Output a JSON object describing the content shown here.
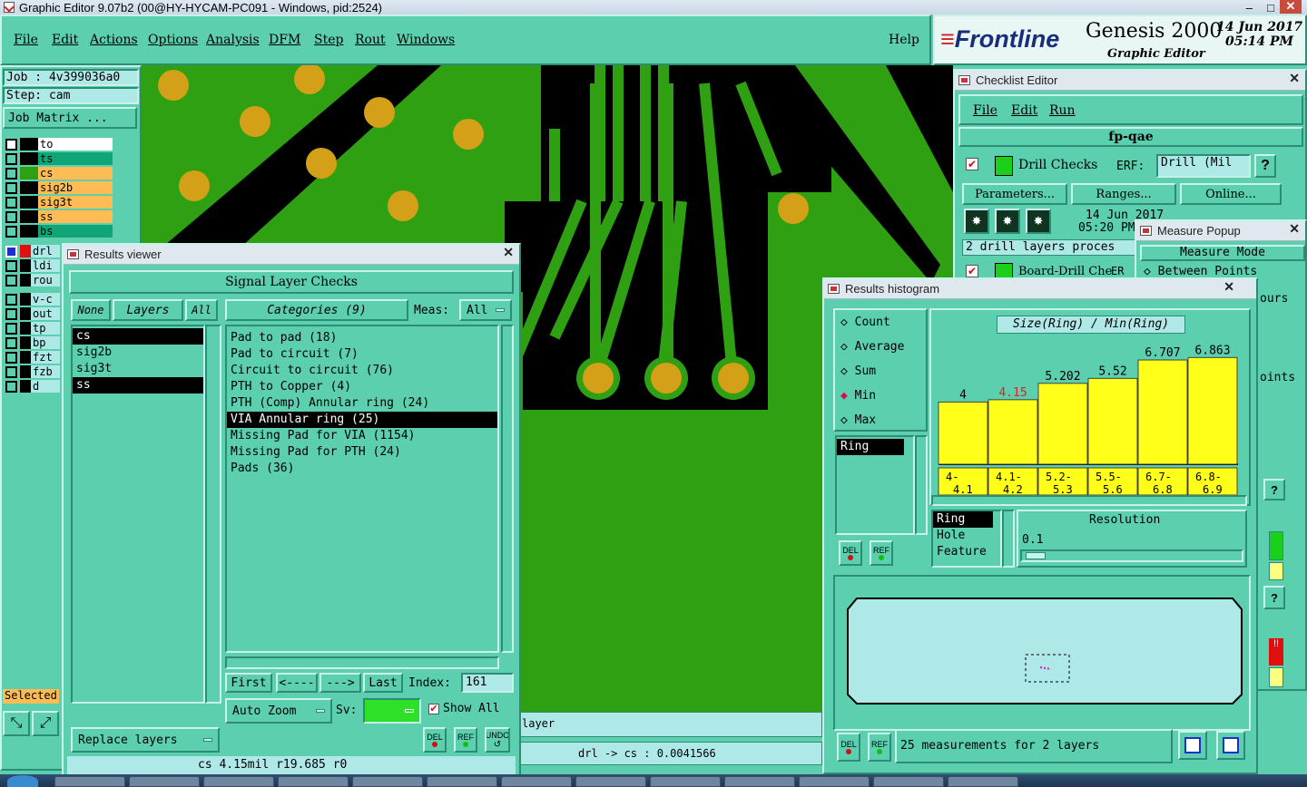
{
  "window_title": "Graphic Editor 9.07b2 (00@HY-HYCAM-PC091 - Windows, pid:2524)",
  "menu": [
    "File",
    "Edit",
    "Actions",
    "Options",
    "Analysis",
    "DFM",
    "Step",
    "Rout",
    "Windows"
  ],
  "help": "Help",
  "brand": {
    "logo": "Frontline",
    "product": "Genesis 2000",
    "subtitle": "Graphic Editor",
    "date": "14 Jun 2017",
    "time": "05:14 PM"
  },
  "job": {
    "job": "Job : 4v399036a0",
    "step": "Step: cam",
    "matrix": "Job Matrix ..."
  },
  "layers_top": [
    {
      "name": "to",
      "color": "#ffffff"
    },
    {
      "name": "ts",
      "color": "#ffb347"
    },
    {
      "name": "cs",
      "color": "#ffb347"
    },
    {
      "name": "sig2b",
      "color": "#ffb347"
    },
    {
      "name": "sig3t",
      "color": "#ffb347"
    },
    {
      "name": "ss",
      "color": "#ffb347"
    },
    {
      "name": "bs",
      "color": "#ffb347"
    }
  ],
  "layers_mid": [
    "drl",
    "ldi",
    "rou"
  ],
  "layers_bot": [
    "v-c",
    "out",
    "tp",
    "bp",
    "fzt",
    "fzb",
    "d"
  ],
  "selected_label": "Selected",
  "results_viewer": {
    "title": "Results viewer",
    "header": "Signal Layer Checks",
    "none_btn": "None",
    "layers_btn": "Layers",
    "all_btn": "All",
    "layers": [
      "cs",
      "sig2b",
      "sig3t",
      "ss"
    ],
    "categories_btn": "Categories (9)",
    "meas_label": "Meas:",
    "meas_value": "All",
    "categories": [
      "Pad to pad (18)",
      "Pad to circuit (7)",
      "Circuit to circuit (76)",
      "PTH to Copper (4)",
      "PTH (Comp) Annular ring (24)",
      "VIA Annular ring (25)",
      "Missing Pad for VIA (1154)",
      "Missing Pad for PTH (24)",
      "Pads (36)"
    ],
    "selected_category": 5,
    "nav": {
      "first": "First",
      "prev": "<----",
      "next": "--->",
      "last": "Last",
      "index_label": "Index:",
      "index_value": "161"
    },
    "auto_zoom": "Auto Zoom",
    "sv_label": "Sv:",
    "show_all": "Show All",
    "replace_layers": "Replace layers",
    "del": "DEL",
    "ref": "REF",
    "undo": "UNDO",
    "status": "cs 4.15mil   r19.685   r0"
  },
  "status_bar": {
    "layer_text": "layer",
    "measure": "drl -> cs : 0.0041566"
  },
  "checklist": {
    "title": "Checklist Editor",
    "menu": [
      "File",
      "Edit",
      "Run"
    ],
    "name": "fp-qae",
    "check1": "Drill Checks",
    "erf_label": "ERF:",
    "erf_value": "Drill (Mil",
    "params": "Parameters...",
    "ranges": "Ranges...",
    "online": "Online...",
    "date": "14 Jun 2017",
    "time": "05:20 PM",
    "status_line": "2 drill layers proces",
    "check2": "Board-Drill Che",
    "erf2": "ER"
  },
  "measure_popup": {
    "title": "Measure Popup",
    "mode": "Measure Mode",
    "between": "Between Points",
    "ours": "ours",
    "oints": "oints"
  },
  "histogram": {
    "title": "Results histogram",
    "options": [
      "Count",
      "Average",
      "Sum",
      "Min",
      "Max"
    ],
    "selected_option": "Min",
    "header": "Size(Ring) / Min(Ring)",
    "list_top": [
      "Ring"
    ],
    "list_bottom": [
      "Ring",
      "Hole",
      "Feature"
    ],
    "resolution_label": "Resolution",
    "resolution_value": "0.1",
    "summary": "25 measurements for 2 layers",
    "del": "DEL",
    "ref": "REF"
  },
  "chart_data": {
    "type": "bar",
    "categories": [
      "4-4.1",
      "4.1-4.2",
      "5.2-5.3",
      "5.5-5.6",
      "6.7-6.8",
      "6.8-6.9"
    ],
    "values": [
      4,
      4.15,
      5.202,
      5.52,
      6.707,
      6.863
    ],
    "value_labels": [
      "4",
      "4.15",
      "5.202",
      "5.52",
      "6.707",
      "6.863"
    ],
    "highlight_index": 1,
    "ylim": [
      0,
      7
    ],
    "title": "Size(Ring) / Min(Ring)",
    "colors": {
      "bar": "#ffff1a",
      "highlight_label": "#e02020"
    }
  }
}
